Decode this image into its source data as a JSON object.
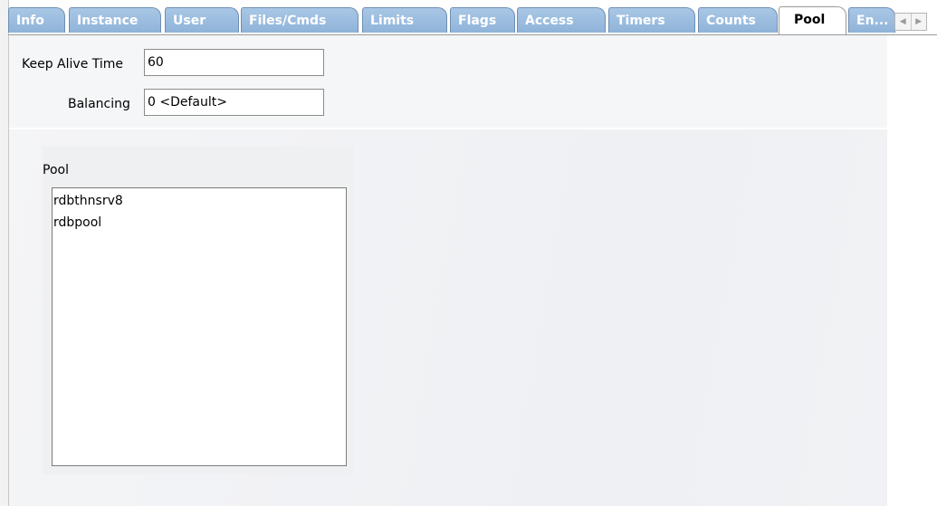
{
  "tabs": [
    {
      "label": "Info",
      "active": false
    },
    {
      "label": "Instance",
      "active": false
    },
    {
      "label": "User",
      "active": false
    },
    {
      "label": "Files/Cmds",
      "active": false
    },
    {
      "label": "Limits",
      "active": false
    },
    {
      "label": "Flags",
      "active": false
    },
    {
      "label": "Access",
      "active": false
    },
    {
      "label": "Timers",
      "active": false
    },
    {
      "label": "Counts",
      "active": false
    },
    {
      "label": "Pool",
      "active": true
    },
    {
      "label": "En...",
      "active": false
    }
  ],
  "tab_scroll": {
    "left_icon": "chevron-left-icon",
    "right_icon": "chevron-right-icon"
  },
  "form": {
    "keep_alive_label": "Keep Alive Time",
    "keep_alive_value": "60",
    "balancing_label": "Balancing",
    "balancing_value": "0  <Default>"
  },
  "pool": {
    "label": "Pool",
    "items": [
      "rdbthnsrv8",
      "rdbpool"
    ]
  },
  "colors": {
    "tab_inactive": "#8fb3d8",
    "tab_active": "#ffffff",
    "panel_bg": "#f1f2f5"
  }
}
